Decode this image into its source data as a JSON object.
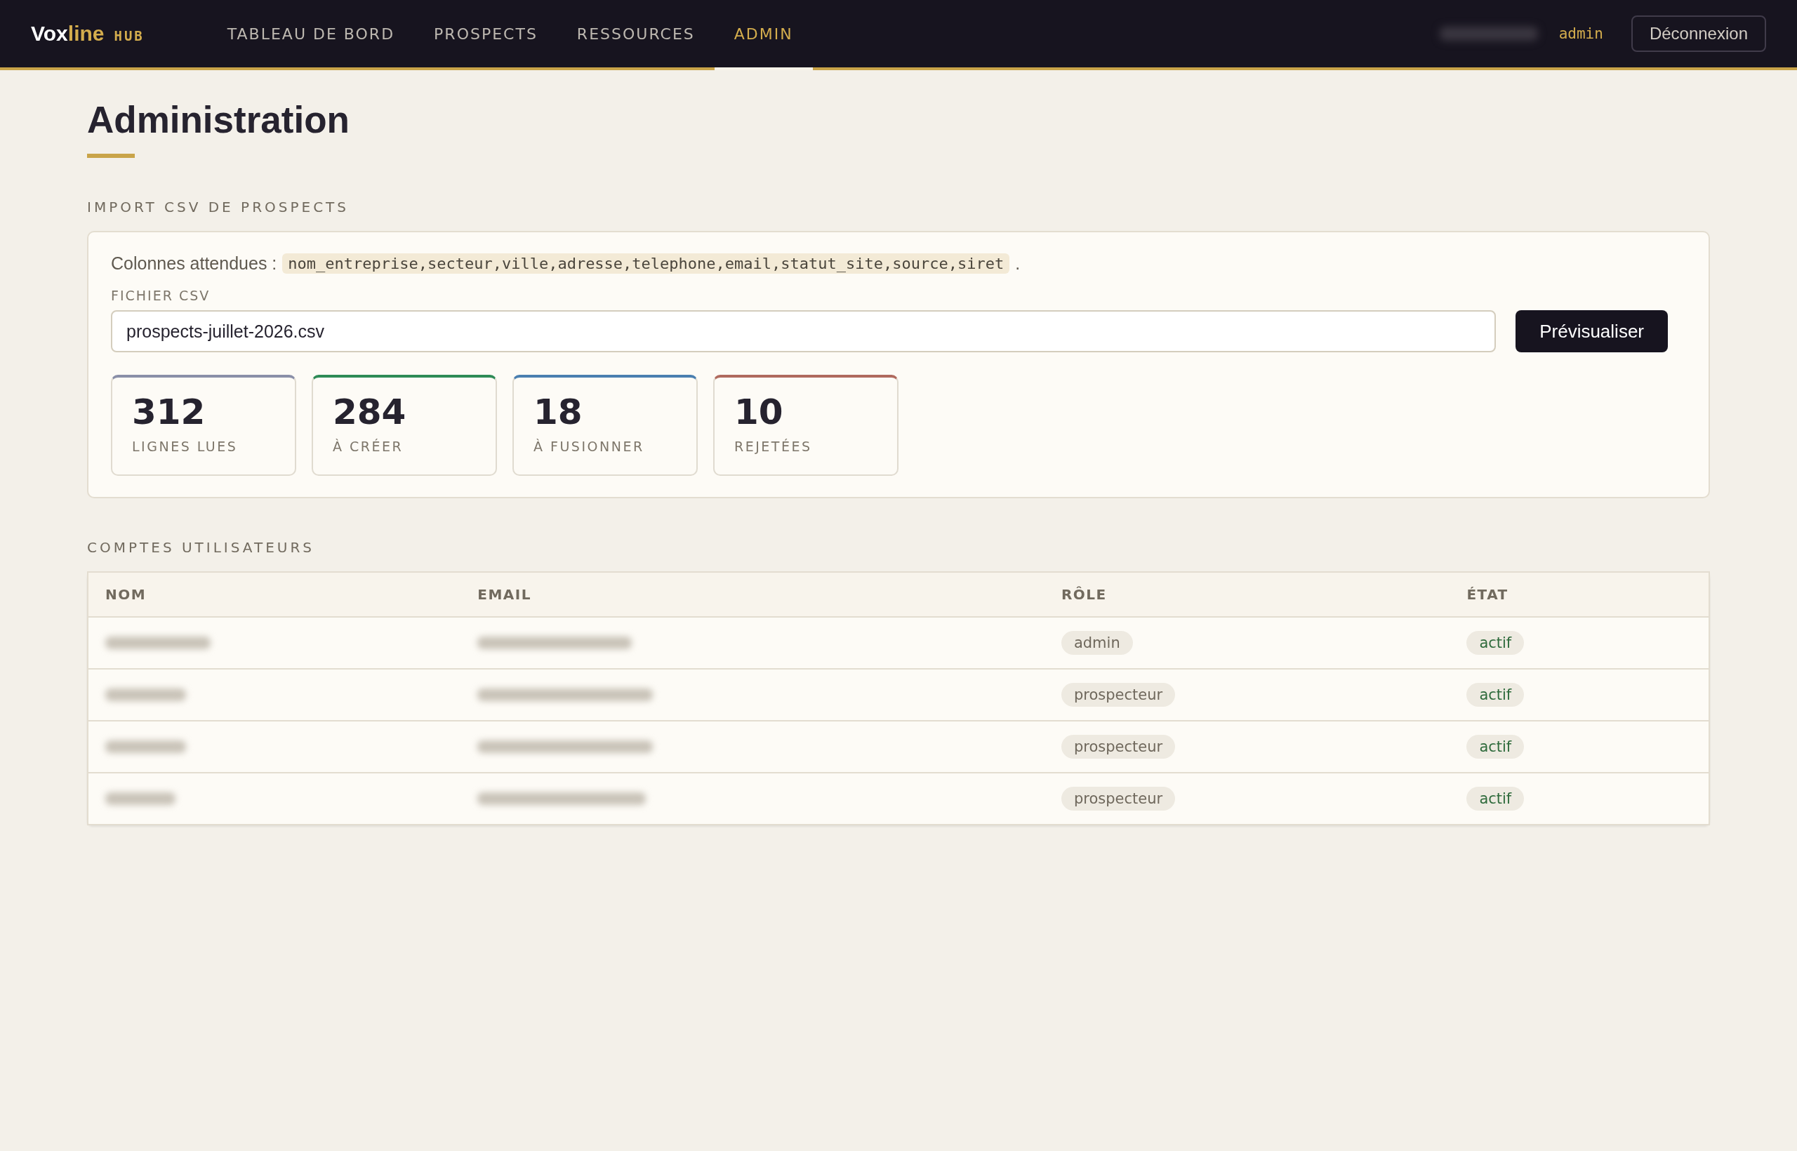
{
  "nav": {
    "logo": {
      "main": "Vox",
      "accent": "line",
      "tag": "HUB"
    },
    "items": [
      {
        "label": "TABLEAU DE BORD",
        "selected": false
      },
      {
        "label": "PROSPECTS",
        "selected": false
      },
      {
        "label": "RESSOURCES",
        "selected": false
      },
      {
        "label": "ADMIN",
        "selected": true
      }
    ],
    "role": "admin",
    "logout": "Déconnexion"
  },
  "title": "Administration",
  "import": {
    "heading": "IMPORT CSV DE PROSPECTS",
    "intro": "Colonnes attendues :",
    "columns": "nom_entreprise,secteur,ville,adresse,telephone,email,statut_site,source,siret",
    "after": ".",
    "file_label": "FICHIER CSV",
    "file_value": "prospects-juillet-2026.csv",
    "preview": "Prévisualiser",
    "stats": [
      {
        "value": "312",
        "label": "LIGNES LUES",
        "color": "#8a8fa8"
      },
      {
        "value": "284",
        "label": "À CRÉER",
        "color": "#2e8b57"
      },
      {
        "value": "18",
        "label": "À FUSIONNER",
        "color": "#4a7fb0"
      },
      {
        "value": "10",
        "label": "REJETÉES",
        "color": "#b06a5e"
      }
    ]
  },
  "users": {
    "heading": "COMPTES UTILISATEURS",
    "columns": [
      "NOM",
      "EMAIL",
      "RÔLE",
      "ÉTAT"
    ],
    "rows": [
      {
        "role": "admin",
        "state": "actif"
      },
      {
        "role": "prospecteur",
        "state": "actif"
      },
      {
        "role": "prospecteur",
        "state": "actif"
      },
      {
        "role": "prospecteur",
        "state": "actif"
      }
    ]
  }
}
